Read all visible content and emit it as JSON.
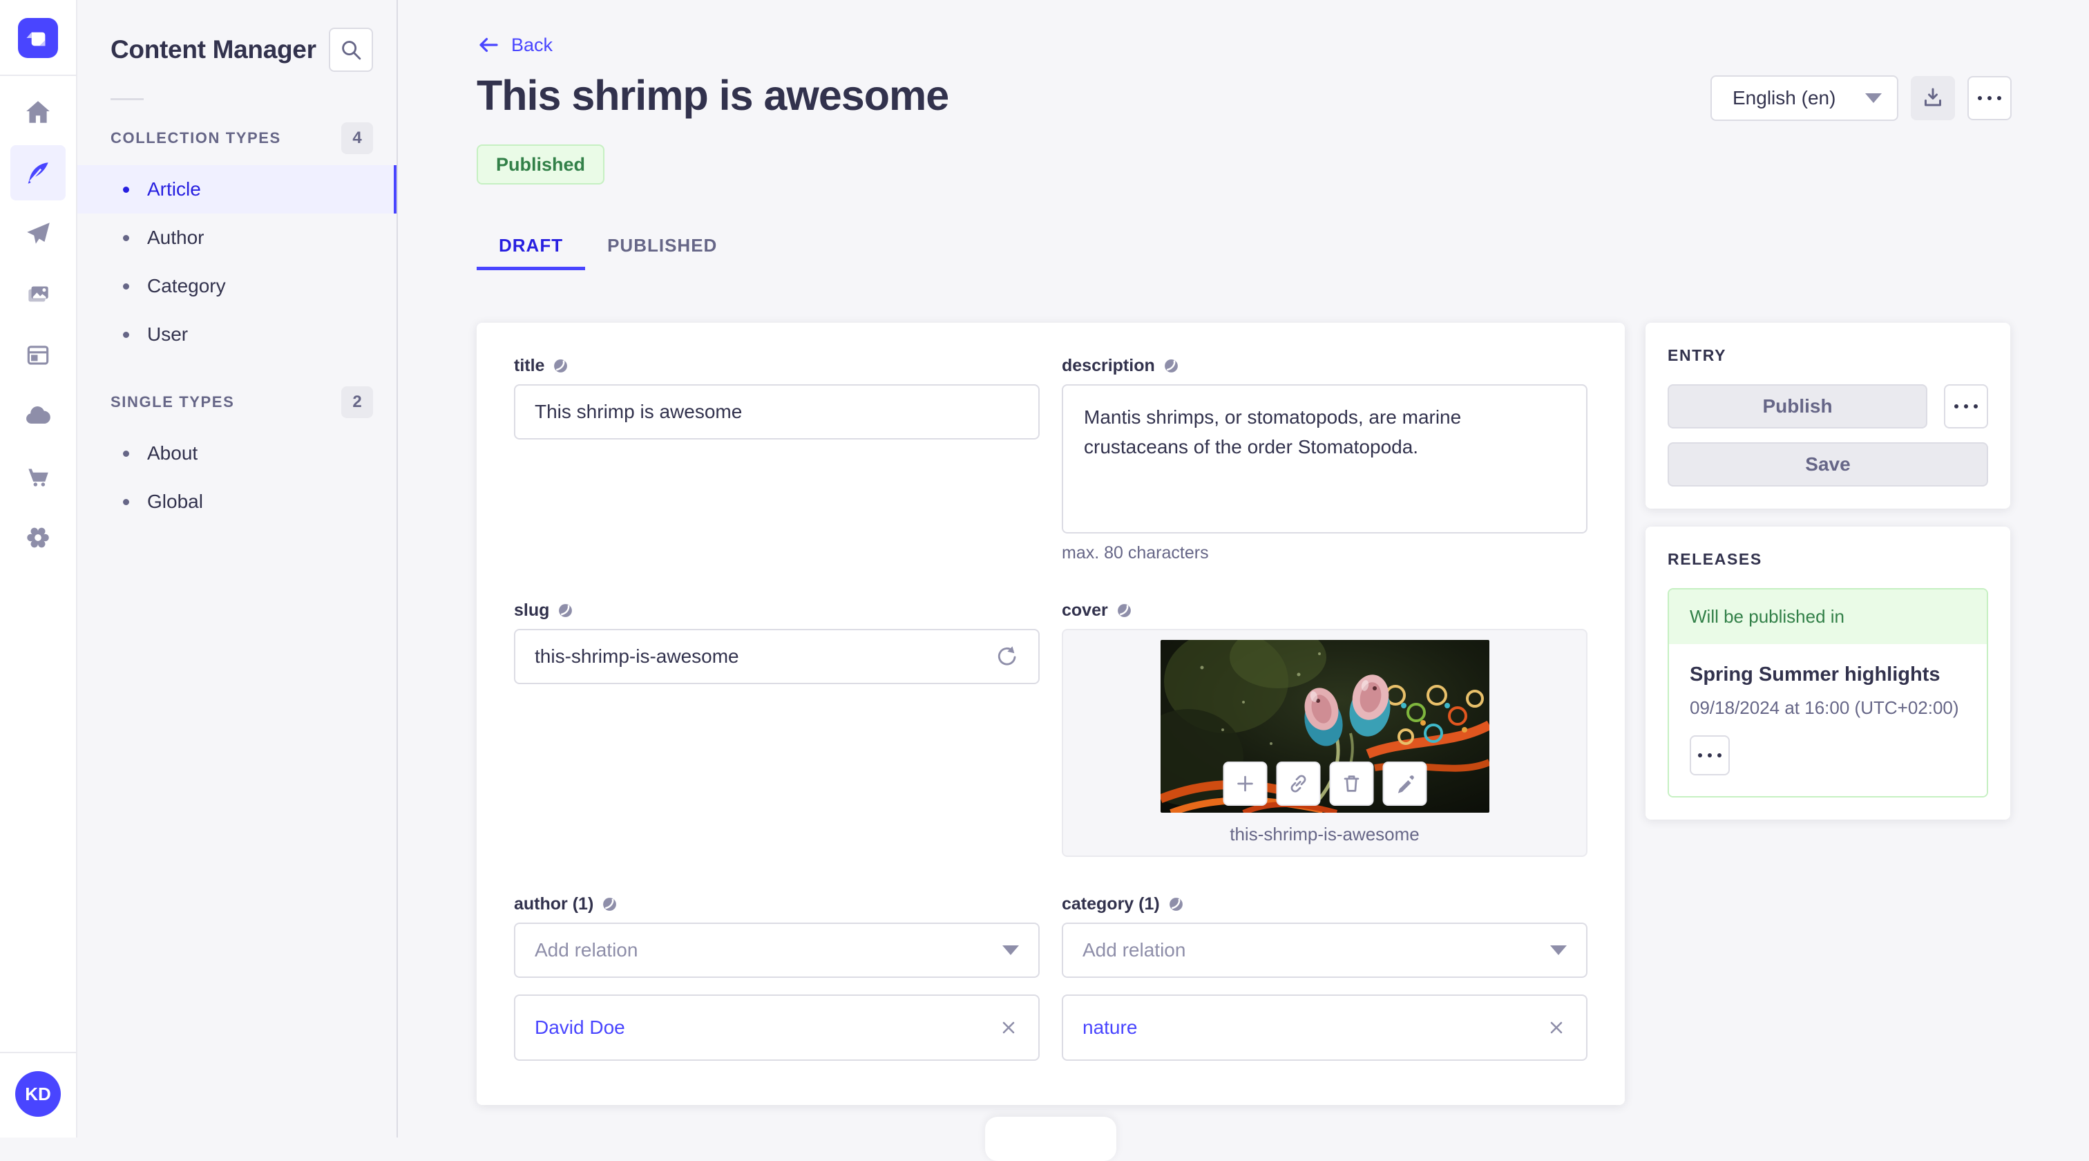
{
  "nav": {
    "avatar_initials": "KD",
    "icons": [
      "strapi-logo",
      "home",
      "content-manager-feather",
      "send",
      "media-library",
      "content-type-builder",
      "cloud",
      "marketplace-cart",
      "settings-gear"
    ]
  },
  "subnav": {
    "title": "Content Manager",
    "sections": [
      {
        "label": "COLLECTION TYPES",
        "count": "4",
        "items": [
          {
            "label": "Article",
            "active": true
          },
          {
            "label": "Author",
            "active": false
          },
          {
            "label": "Category",
            "active": false
          },
          {
            "label": "User",
            "active": false
          }
        ]
      },
      {
        "label": "SINGLE TYPES",
        "count": "2",
        "items": [
          {
            "label": "About",
            "active": false
          },
          {
            "label": "Global",
            "active": false
          }
        ]
      }
    ]
  },
  "header": {
    "back_label": "Back",
    "title": "This shrimp is awesome",
    "status_badge": "Published",
    "language_select": "English (en)",
    "tabs": [
      {
        "label": "DRAFT",
        "active": true
      },
      {
        "label": "PUBLISHED",
        "active": false
      }
    ]
  },
  "form": {
    "title_field": {
      "label": "title",
      "value": "This shrimp is awesome"
    },
    "description_field": {
      "label": "description",
      "value": "Mantis shrimps, or stomatopods, are marine crustaceans of the order Stomatopoda.",
      "hint": "max. 80 characters"
    },
    "slug_field": {
      "label": "slug",
      "value": "this-shrimp-is-awesome"
    },
    "cover_field": {
      "label": "cover",
      "filename": "this-shrimp-is-awesome"
    },
    "author_field": {
      "label": "author (1)",
      "placeholder": "Add relation",
      "relations": [
        "David Doe"
      ]
    },
    "category_field": {
      "label": "category (1)",
      "placeholder": "Add relation",
      "relations": [
        "nature"
      ]
    }
  },
  "entry_panel": {
    "heading": "ENTRY",
    "publish_label": "Publish",
    "save_label": "Save"
  },
  "releases_panel": {
    "heading": "RELEASES",
    "status": "Will be published in",
    "release_name": "Spring Summer highlights",
    "release_date": "09/18/2024 at 16:00 (UTC+02:00)"
  },
  "colors": {
    "primary": "#4945ff",
    "primary_text": "#271fe0",
    "primary_bg": "#f0f0ff",
    "success_text": "#328048",
    "success_bg": "#eafbe7",
    "success_border": "#c6f0c2",
    "neutral_bg": "#f6f6f9"
  }
}
